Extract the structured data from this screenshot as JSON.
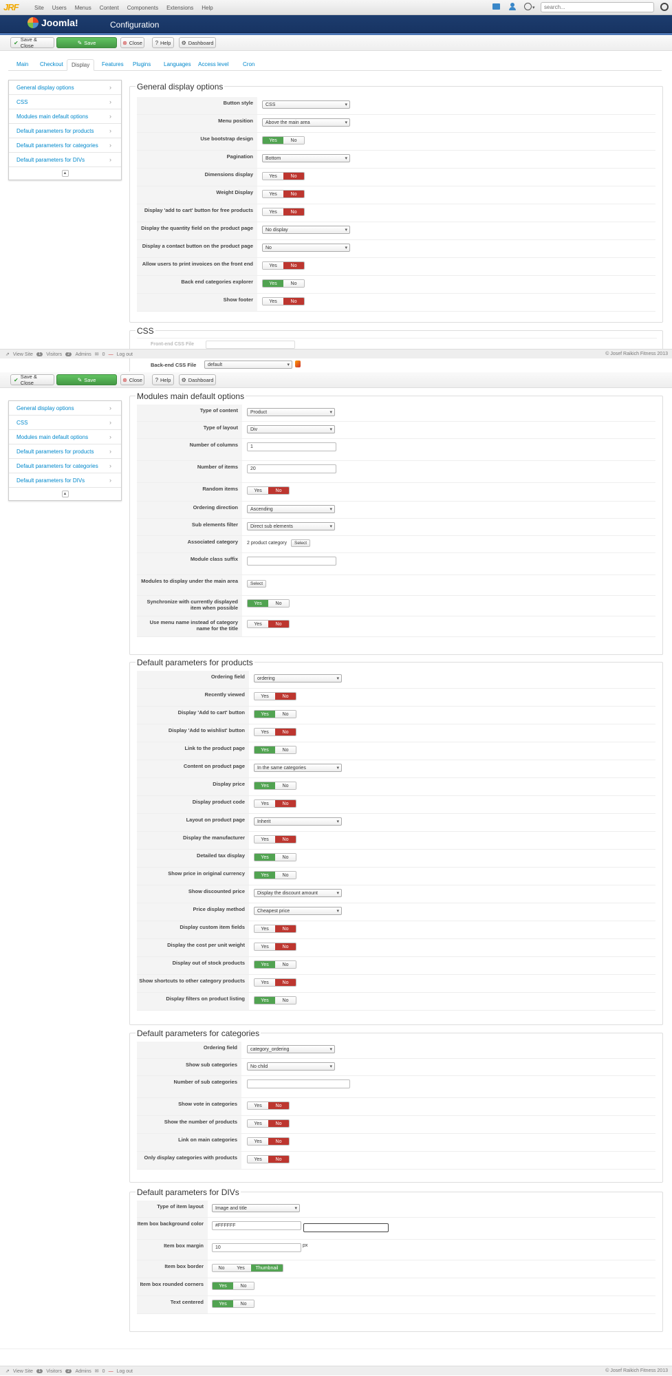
{
  "brand": "JRF",
  "topnav": [
    "Site",
    "Users",
    "Menus",
    "Content",
    "Components",
    "Extensions",
    "Help"
  ],
  "search": {
    "placeholder": "search..."
  },
  "header": {
    "logo_text": "Joomla!",
    "title": "Configuration"
  },
  "toolbar": {
    "save_close": "Save & Close",
    "save": "Save",
    "close": "Close",
    "help": "Help",
    "dashboard": "Dashboard"
  },
  "tabs": [
    "Main",
    "Checkout",
    "Display",
    "Features",
    "Plugins",
    "Languages",
    "Access level",
    "Cron"
  ],
  "active_tab": "Display",
  "sidebar": [
    "General display options",
    "CSS",
    "Modules main default options",
    "Default parameters for products",
    "Default parameters for categories",
    "Default parameters for DIVs"
  ],
  "toggle": {
    "yes": "Yes",
    "no": "No",
    "thumbnail": "Thumbnail"
  },
  "general": {
    "legend": "General display options",
    "rows": [
      {
        "label": "Button style",
        "type": "select",
        "value": "CSS"
      },
      {
        "label": "Menu position",
        "type": "select",
        "value": "Above the main area"
      },
      {
        "label": "Use bootstrap design",
        "type": "toggle",
        "value": "Yes"
      },
      {
        "label": "Pagination",
        "type": "select",
        "value": "Bottom"
      },
      {
        "label": "Dimensions display",
        "type": "toggle",
        "value": "No"
      },
      {
        "label": "Weight Display",
        "type": "toggle",
        "value": "No"
      },
      {
        "label": "Display 'add to cart' button for free products",
        "type": "toggle",
        "value": "No"
      },
      {
        "label": "Display the quantity field on the product page",
        "type": "select",
        "value": "No display"
      },
      {
        "label": "Display a contact button on the product page",
        "type": "select",
        "value": "No"
      },
      {
        "label": "Allow users to print invoices on the front end",
        "type": "toggle",
        "value": "No"
      },
      {
        "label": "Back end categories explorer",
        "type": "toggle",
        "value": "Yes"
      },
      {
        "label": "Show footer",
        "type": "toggle",
        "value": "No"
      }
    ]
  },
  "css": {
    "legend": "CSS",
    "partial_label": "Front-end CSS File",
    "backend_label": "Back-end CSS File",
    "backend_value": "default"
  },
  "status": {
    "view_site": "View Site",
    "visitors_count": "1",
    "visitors": "Visitors",
    "admins_count": "2",
    "admins": "Admins",
    "messages_count": "0",
    "logout": "Log out",
    "copyright": "© Josef Raikich Fitness 2013"
  },
  "modules": {
    "legend": "Modules main default options",
    "rows": [
      {
        "label": "Type of content",
        "type": "select",
        "value": "Product"
      },
      {
        "label": "Type of layout",
        "type": "select",
        "value": "Div"
      },
      {
        "label": "Number of columns",
        "type": "input",
        "value": "1"
      },
      {
        "label": "Number of items",
        "type": "input",
        "value": "20"
      },
      {
        "label": "Random items",
        "type": "toggle",
        "value": "No"
      },
      {
        "label": "Ordering direction",
        "type": "select",
        "value": "Ascending"
      },
      {
        "label": "Sub elements filter",
        "type": "select",
        "value": "Direct sub elements"
      },
      {
        "label": "Associated category",
        "type": "textbtn",
        "value": "2 product category",
        "button": "Select"
      },
      {
        "label": "Module class suffix",
        "type": "input",
        "value": ""
      },
      {
        "label": "Modules to display under the main area",
        "type": "button",
        "button": "Select"
      },
      {
        "label": "Synchronize with currently displayed item when possible",
        "type": "toggle",
        "value": "Yes"
      },
      {
        "label": "Use menu name instead of category name for the title",
        "type": "toggle",
        "value": "No"
      }
    ]
  },
  "products": {
    "legend": "Default parameters for products",
    "rows": [
      {
        "label": "Ordering field",
        "type": "select",
        "value": "ordering"
      },
      {
        "label": "Recently viewed",
        "type": "toggle",
        "value": "No"
      },
      {
        "label": "Display 'Add to cart' button",
        "type": "toggle",
        "value": "Yes"
      },
      {
        "label": "Display 'Add to wishlist' button",
        "type": "toggle",
        "value": "No"
      },
      {
        "label": "Link to the product page",
        "type": "toggle",
        "value": "Yes"
      },
      {
        "label": "Content on product page",
        "type": "select",
        "value": "In the same categories"
      },
      {
        "label": "Display price",
        "type": "toggle",
        "value": "Yes"
      },
      {
        "label": "Display product code",
        "type": "toggle",
        "value": "No"
      },
      {
        "label": "Layout on product page",
        "type": "select",
        "value": "Inherit"
      },
      {
        "label": "Display the manufacturer",
        "type": "toggle",
        "value": "No"
      },
      {
        "label": "Detailed tax display",
        "type": "toggle",
        "value": "Yes"
      },
      {
        "label": "Show price in original currency",
        "type": "toggle",
        "value": "Yes"
      },
      {
        "label": "Show discounted price",
        "type": "select",
        "value": "Display the discount amount"
      },
      {
        "label": "Price display method",
        "type": "select",
        "value": "Cheapest price"
      },
      {
        "label": "Display custom item fields",
        "type": "toggle",
        "value": "No"
      },
      {
        "label": "Display the cost per unit weight",
        "type": "toggle",
        "value": "No"
      },
      {
        "label": "Display out of stock products",
        "type": "toggle",
        "value": "Yes"
      },
      {
        "label": "Show shortcuts to other category products",
        "type": "toggle",
        "value": "No"
      },
      {
        "label": "Display filters on product listing",
        "type": "toggle",
        "value": "Yes"
      }
    ]
  },
  "categories": {
    "legend": "Default parameters for categories",
    "rows": [
      {
        "label": "Ordering field",
        "type": "select",
        "value": "category_ordering"
      },
      {
        "label": "Show sub categories",
        "type": "select",
        "value": "No child"
      },
      {
        "label": "Number of sub categories",
        "type": "input",
        "value": ""
      },
      {
        "label": "Show vote in categories",
        "type": "toggle",
        "value": "No"
      },
      {
        "label": "Show the number of products",
        "type": "toggle",
        "value": "No"
      },
      {
        "label": "Link on main categories",
        "type": "toggle",
        "value": "No"
      },
      {
        "label": "Only display categories with products",
        "type": "toggle",
        "value": "No"
      }
    ]
  },
  "divs": {
    "legend": "Default parameters for DIVs",
    "rows": [
      {
        "label": "Type of item layout",
        "type": "select",
        "value": "Image and title"
      },
      {
        "label": "Item box background color",
        "type": "color",
        "value": "#FFFFFF"
      },
      {
        "label": "Item box margin",
        "type": "inputunit",
        "value": "10",
        "unit": "px"
      },
      {
        "label": "Item box border",
        "type": "toggle3",
        "value": "Thumbnail"
      },
      {
        "label": "Item box rounded corners",
        "type": "toggle",
        "value": "Yes"
      },
      {
        "label": "Text centered",
        "type": "toggle",
        "value": "Yes"
      }
    ]
  }
}
